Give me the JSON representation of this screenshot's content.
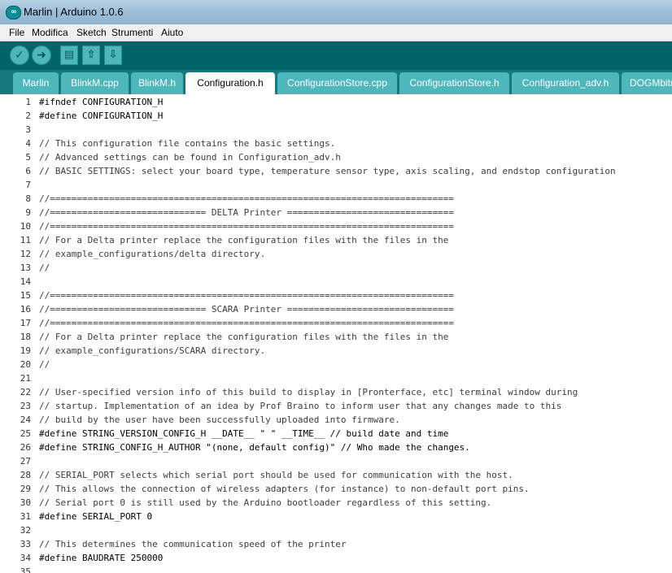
{
  "window": {
    "title": "Marlin | Arduino 1.0.6",
    "icon": "arduino-logo-icon"
  },
  "menu": [
    "File",
    "Modifica",
    "Sketch",
    "Strumenti",
    "Aiuto"
  ],
  "toolbar": {
    "verify": "✓",
    "upload": "➜",
    "new": "▤",
    "open": "⇧",
    "save": "⇩"
  },
  "tabs": [
    "Marlin",
    "BlinkM.cpp",
    "BlinkM.h",
    "Configuration.h",
    "ConfigurationStore.cpp",
    "ConfigurationStore.h",
    "Configuration_adv.h",
    "DOGMbitm"
  ],
  "active_tab": 3,
  "colors": {
    "toolbar": "#006468",
    "tabbar": "#16797e",
    "tab": "#4db7bb"
  },
  "code": [
    {
      "n": "1",
      "t": "#ifndef CONFIGURATION_H"
    },
    {
      "n": "2",
      "t": "#define CONFIGURATION_H"
    },
    {
      "n": "3",
      "t": ""
    },
    {
      "n": "4",
      "t": "// This configuration file contains the basic settings."
    },
    {
      "n": "5",
      "t": "// Advanced settings can be found in Configuration_adv.h"
    },
    {
      "n": "6",
      "t": "// BASIC SETTINGS: select your board type, temperature sensor type, axis scaling, and endstop configuration"
    },
    {
      "n": "7",
      "t": ""
    },
    {
      "n": "8",
      "t": "//==========================================================================="
    },
    {
      "n": "9",
      "t": "//============================= DELTA Printer ==============================="
    },
    {
      "n": "10",
      "t": "//==========================================================================="
    },
    {
      "n": "11",
      "t": "// For a Delta printer replace the configuration files with the files in the"
    },
    {
      "n": "12",
      "t": "// example_configurations/delta directory."
    },
    {
      "n": "13",
      "t": "//"
    },
    {
      "n": "14",
      "t": ""
    },
    {
      "n": "15",
      "t": "//==========================================================================="
    },
    {
      "n": "16",
      "t": "//============================= SCARA Printer ==============================="
    },
    {
      "n": "17",
      "t": "//==========================================================================="
    },
    {
      "n": "18",
      "t": "// For a Delta printer replace the configuration files with the files in the"
    },
    {
      "n": "19",
      "t": "// example_configurations/SCARA directory."
    },
    {
      "n": "20",
      "t": "//"
    },
    {
      "n": "21",
      "t": ""
    },
    {
      "n": "22",
      "t": "// User-specified version info of this build to display in [Pronterface, etc] terminal window during"
    },
    {
      "n": "23",
      "t": "// startup. Implementation of an idea by Prof Braino to inform user that any changes made to this"
    },
    {
      "n": "24",
      "t": "// build by the user have been successfully uploaded into firmware."
    },
    {
      "n": "25",
      "t": "#define STRING_VERSION_CONFIG_H __DATE__ \" \" __TIME__ // build date and time"
    },
    {
      "n": "26",
      "t": "#define STRING_CONFIG_H_AUTHOR \"(none, default config)\" // Who made the changes."
    },
    {
      "n": "27",
      "t": ""
    },
    {
      "n": "28",
      "t": "// SERIAL_PORT selects which serial port should be used for communication with the host."
    },
    {
      "n": "29",
      "t": "// This allows the connection of wireless adapters (for instance) to non-default port pins."
    },
    {
      "n": "30",
      "t": "// Serial port 0 is still used by the Arduino bootloader regardless of this setting."
    },
    {
      "n": "31",
      "t": "#define SERIAL_PORT 0"
    },
    {
      "n": "32",
      "t": ""
    },
    {
      "n": "33",
      "t": "// This determines the communication speed of the printer"
    },
    {
      "n": "34",
      "t": "#define BAUDRATE 250000"
    },
    {
      "n": "35",
      "t": ""
    }
  ]
}
